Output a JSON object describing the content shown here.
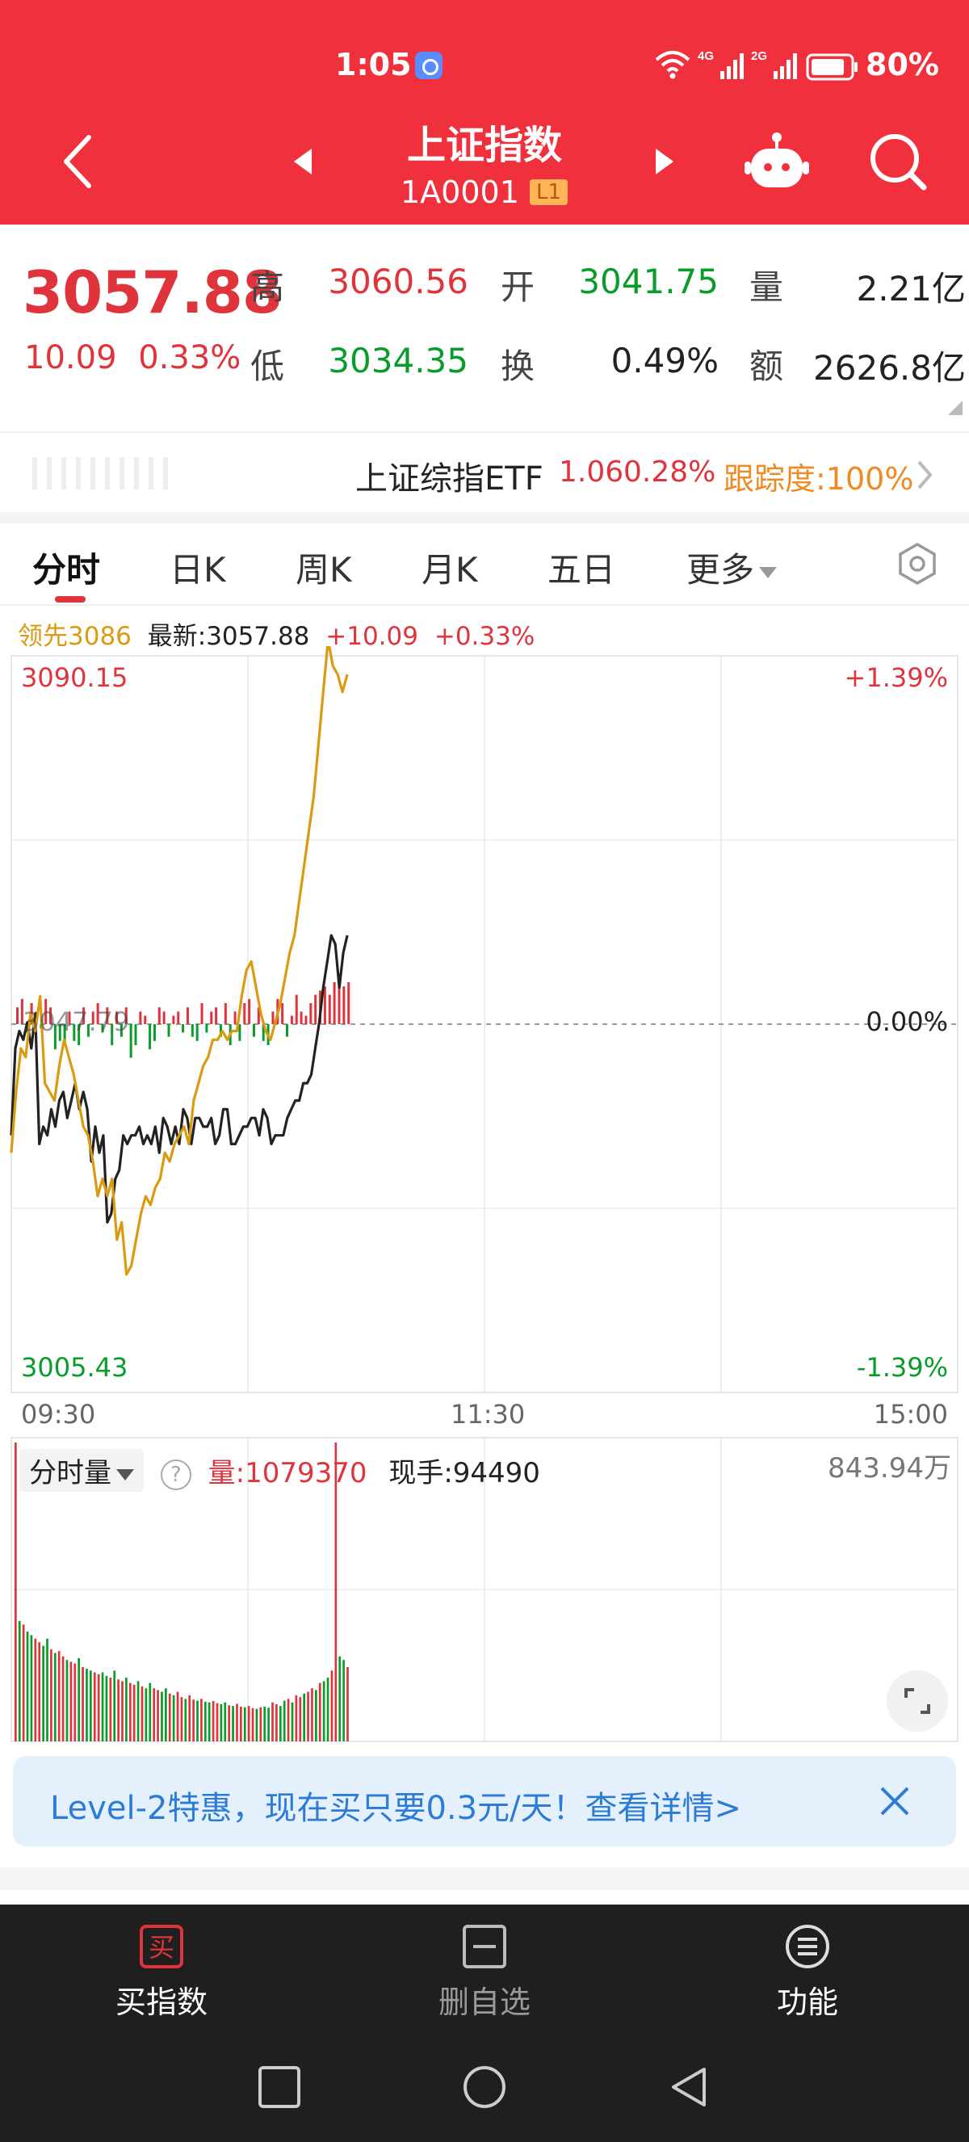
{
  "status_bar": {
    "time": "1:05",
    "net1": "4G",
    "net2": "2G",
    "battery": "80%"
  },
  "header": {
    "title": "上证指数",
    "code": "1A0001",
    "level": "L1"
  },
  "quote": {
    "price": "3057.88",
    "change": "10.09",
    "change_pct": "0.33%",
    "high_label": "高",
    "high": "3060.56",
    "low_label": "低",
    "low": "3034.35",
    "open_label": "开",
    "open": "3041.75",
    "turnover_label": "换",
    "turnover": "0.49%",
    "volume_label": "量",
    "volume": "2.21亿",
    "amount_label": "额",
    "amount": "2626.8亿"
  },
  "etf": {
    "name": "上证综指ETF",
    "price": "1.06",
    "pct": "0.28%",
    "track": "跟踪度:100%"
  },
  "tabs": [
    "分时",
    "日K",
    "周K",
    "月K",
    "五日",
    "更多"
  ],
  "chart_info": {
    "lead": "领先3086",
    "latest": "最新:3057.88",
    "change": "+10.09",
    "pct": "+0.33%"
  },
  "price_chart": {
    "y_max": "3090.15",
    "y_min": "3005.43",
    "pct_max": "+1.39%",
    "pct_zero": "0.00%",
    "pct_min": "-1.39%",
    "prev_close_label": "3047.79",
    "time_start": "09:30",
    "time_mid": "11:30",
    "time_end": "15:00"
  },
  "volume_header": {
    "selector": "分时量",
    "help": "?",
    "volume": "量:1079370",
    "current": "现手:94490",
    "max": "843.94万"
  },
  "banner": {
    "text": "Level-2特惠，现在买只要0.3元/天！查看详情>"
  },
  "bottom_bar": {
    "buy_icon_char": "买",
    "buy_label": "买指数",
    "remove_label": "删自选",
    "func_label": "功能"
  },
  "colors": {
    "header_red": "#f0313d",
    "up": "#e0343c",
    "down": "#0a9c2a",
    "lead_line": "#d89b12",
    "price_line": "#222222"
  },
  "chart_data": [
    {
      "type": "line",
      "title": "",
      "xlabel": "",
      "ylabel": "",
      "x_ticks": [
        "09:30",
        "11:30",
        "15:00"
      ],
      "ylim": [
        3005.43,
        3090.15
      ],
      "prev_close": 3047.79,
      "series": [
        {
          "name": "最新",
          "values": [
            3035,
            3045,
            3047,
            3046,
            3048,
            3045,
            3049,
            3034,
            3036,
            3035,
            3038,
            3036,
            3039,
            3040,
            3037,
            3039,
            3041,
            3038,
            3040,
            3038,
            3032,
            3036,
            3033,
            3035,
            3025,
            3026,
            3030,
            3031,
            3035,
            3034,
            3035,
            3035,
            3036,
            3034,
            3035,
            3034,
            3036,
            3033,
            3037,
            3036,
            3034,
            3036,
            3034,
            3038,
            3037,
            3034,
            3037,
            3037,
            3036,
            3036,
            3037,
            3034,
            3035,
            3038,
            3038,
            3034,
            3034,
            3035,
            3036,
            3036,
            3037,
            3037,
            3035,
            3038,
            3037,
            3034,
            3035,
            3035,
            3035,
            3037,
            3038,
            3039,
            3039,
            3041,
            3041,
            3042,
            3045,
            3048,
            3052,
            3055,
            3058,
            3057,
            3052,
            3056,
            3058
          ]
        },
        {
          "name": "领先",
          "values": [
            3033,
            3040,
            3045,
            3044,
            3049,
            3047,
            3051,
            3041,
            3040,
            3039,
            3043,
            3046,
            3044,
            3042,
            3039,
            3036,
            3035,
            3032,
            3028,
            3030,
            3028,
            3030,
            3023,
            3025,
            3019,
            3020,
            3023,
            3026,
            3028,
            3027,
            3029,
            3030,
            3033,
            3032,
            3034,
            3035,
            3036,
            3034,
            3039,
            3041,
            3043,
            3044,
            3046,
            3046,
            3047,
            3046,
            3047,
            3047,
            3051,
            3054,
            3055,
            3052,
            3049,
            3047,
            3046,
            3048,
            3050,
            3053,
            3056,
            3058,
            3062,
            3066,
            3070,
            3074,
            3080,
            3086,
            3092,
            3089,
            3088,
            3086,
            3088
          ]
        }
      ],
      "bar_values": [
        4,
        6,
        -2,
        5,
        3,
        -1,
        6,
        4,
        -6,
        -4,
        -5,
        3,
        -4,
        -5,
        4,
        -3,
        3,
        5,
        -2,
        4,
        -5,
        3,
        -3,
        4,
        -8,
        -5,
        3,
        2,
        -6,
        -4,
        4,
        3,
        -3,
        2,
        3,
        -2,
        4,
        -3,
        -4,
        5,
        -2,
        3,
        4,
        -3,
        5,
        -5,
        3,
        -4,
        5,
        6,
        -3,
        4,
        -4,
        -5,
        3,
        6,
        5,
        -3,
        2,
        7,
        3,
        2,
        5,
        7,
        8,
        9,
        7,
        10,
        12,
        9,
        10
      ]
    },
    {
      "type": "bar",
      "title": "",
      "xlabel": "",
      "ylabel": "",
      "max_label": "843.94万",
      "ylim": [
        0,
        843.94
      ],
      "values": [
        843.94,
        340,
        330,
        310,
        300,
        290,
        280,
        270,
        290,
        260,
        250,
        255,
        240,
        230,
        225,
        220,
        235,
        210,
        205,
        200,
        195,
        190,
        195,
        185,
        180,
        200,
        175,
        170,
        180,
        165,
        160,
        170,
        155,
        150,
        165,
        150,
        145,
        140,
        150,
        135,
        130,
        140,
        125,
        120,
        130,
        118,
        115,
        120,
        112,
        110,
        114,
        108,
        105,
        110,
        102,
        100,
        106,
        98,
        96,
        100,
        94,
        92,
        96,
        98,
        95,
        110,
        105,
        100,
        115,
        120,
        110,
        130,
        125,
        135,
        140,
        150,
        145,
        165,
        170,
        180,
        200,
        843.94,
        240,
        230,
        210
      ],
      "colors": "red-up/green-down"
    }
  ]
}
